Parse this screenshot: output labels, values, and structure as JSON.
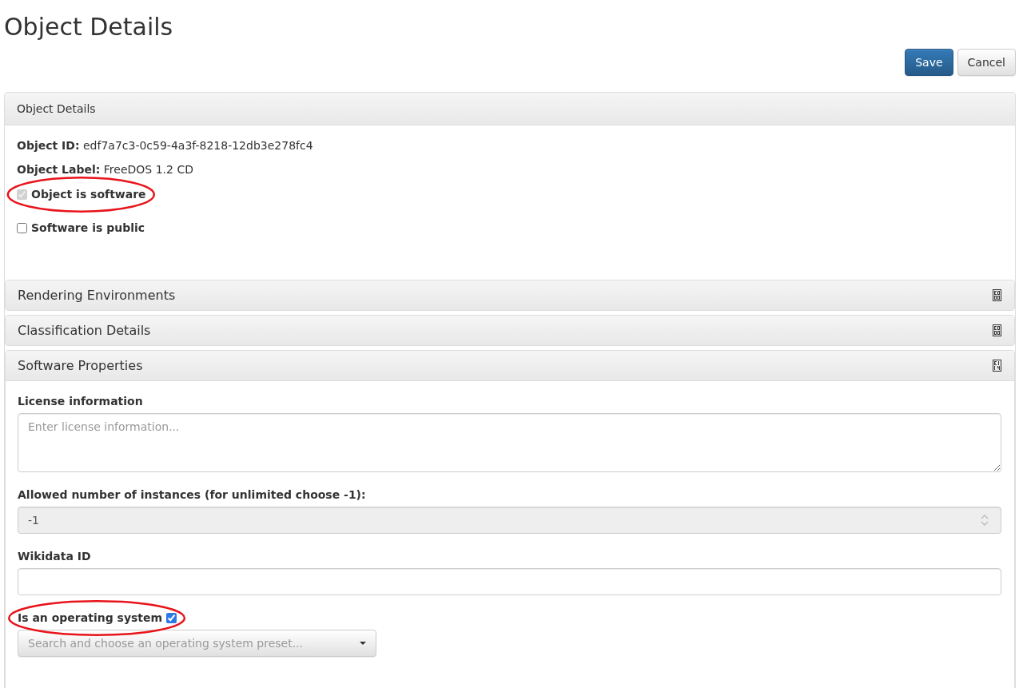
{
  "page": {
    "title": "Object Details"
  },
  "actions": [
    {
      "label": "Save",
      "kind": "primary"
    },
    {
      "label": "Cancel",
      "kind": "default"
    }
  ],
  "object_details": {
    "header": "Object Details",
    "fields": [
      {
        "label": "Object ID:",
        "value": "edf7a7c3-0c59-4a3f-8218-12db3e278fc4"
      },
      {
        "label": "Object Label:",
        "value": "FreeDOS 1.2 CD"
      }
    ],
    "checkboxes": [
      {
        "label": "Object is software",
        "checked": true,
        "disabled": true,
        "circled": true
      },
      {
        "label": "Software is public",
        "checked": false,
        "disabled": false,
        "circled": false
      }
    ]
  },
  "panels": [
    {
      "title": "Rendering Environments",
      "expanded": false
    },
    {
      "title": "Classification Details",
      "expanded": false
    },
    {
      "title": "Software Properties",
      "expanded": true,
      "body": {
        "fields": [
          {
            "kind": "textarea",
            "label": "License information",
            "placeholder": "Enter license information...",
            "disabled": false
          },
          {
            "kind": "number",
            "label": "Allowed number of instances (for unlimited choose -1):",
            "value": "-1",
            "disabled": true
          },
          {
            "kind": "text",
            "label": "Wikidata ID",
            "disabled": false
          },
          {
            "kind": "checkbox",
            "label": "Is an operating system",
            "checked": true,
            "disabled": false,
            "circled": true
          },
          {
            "kind": "select",
            "placeholder": "Search and choose an operating system preset...",
            "disabled": false
          }
        ]
      }
    }
  ]
}
